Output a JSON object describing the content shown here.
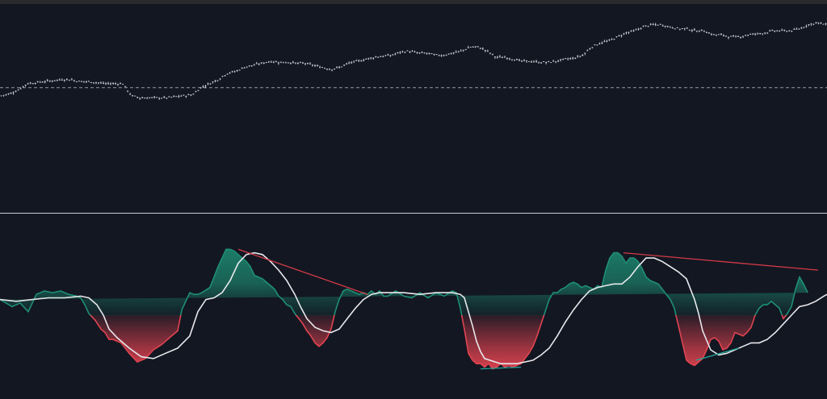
{
  "theme": {
    "background": "#131722",
    "top_bar": "#2a2a2d",
    "candle_color": "#c2c4cb",
    "reference_line_color": "#9598a1",
    "pane_separator_color": "#c9cbd1",
    "bull_fill": "#1f8f74",
    "bear_fill": "#e04451",
    "signal_line": "#e8e8ec",
    "divergence_bear": "#d33a47",
    "divergence_bull": "#26a69a"
  },
  "chart_data": [
    {
      "type": "candlestick",
      "title": "",
      "xlabel": "",
      "ylabel": "",
      "ylim": [
        0,
        100
      ],
      "reference_line": 60,
      "close": [
        56,
        57,
        59,
        62,
        62.5,
        63,
        63.5,
        64,
        64,
        63,
        63,
        62.5,
        62,
        62,
        62,
        56,
        55,
        55,
        55,
        55,
        55.5,
        56,
        56.5,
        60,
        62,
        64,
        67,
        68,
        70,
        71,
        72,
        73,
        72.5,
        72.5,
        72,
        72,
        71,
        70,
        69,
        70,
        72,
        73,
        74,
        75,
        75.5,
        76,
        77.5,
        78,
        77,
        77,
        76,
        76,
        77,
        78,
        80,
        80,
        78,
        75,
        75,
        74,
        73,
        73,
        72.5,
        72.5,
        73,
        74,
        74.5,
        76,
        80,
        82,
        83,
        85,
        87,
        88,
        90,
        91,
        91,
        90,
        89,
        89,
        88,
        88,
        86,
        86,
        85,
        85,
        86,
        86.5,
        87,
        88,
        88,
        88,
        89,
        91,
        92,
        91
      ]
    },
    {
      "type": "area",
      "title": "",
      "xlabel": "",
      "ylabel": "",
      "ylim": [
        -3.5,
        4.5
      ],
      "baseline": 0,
      "x": [
        0,
        15,
        25,
        35,
        45,
        55,
        65,
        75,
        85,
        95,
        100,
        105,
        110,
        118,
        125,
        130,
        135,
        140,
        150,
        160,
        170,
        180,
        190,
        200,
        210,
        220,
        225,
        230,
        235,
        240,
        245,
        250,
        260,
        270,
        280,
        285,
        290,
        295,
        300,
        305,
        310,
        315,
        320,
        325,
        330,
        335,
        340,
        345,
        350,
        355,
        360,
        365,
        370,
        375,
        380,
        385,
        390,
        395,
        400,
        405,
        410,
        415,
        420,
        425,
        430,
        435,
        440,
        445,
        450,
        455,
        460,
        465,
        470,
        475,
        480,
        490,
        500,
        510,
        520,
        530,
        540,
        550,
        560,
        565,
        570,
        575,
        580,
        585,
        590,
        595,
        600,
        605,
        610,
        615,
        620,
        625,
        630,
        635,
        640,
        645,
        650,
        655,
        660,
        665,
        670,
        675,
        680,
        685,
        690,
        695,
        700,
        705,
        710,
        715,
        720,
        725,
        730,
        735,
        740,
        745,
        750,
        755,
        760,
        765,
        770,
        775,
        780,
        785,
        790,
        795,
        800,
        805,
        810,
        815,
        820,
        825,
        830,
        835,
        840,
        845,
        850,
        855,
        860,
        865,
        870,
        875,
        880,
        885,
        890,
        895,
        900,
        905,
        910,
        915,
        920,
        925,
        930,
        935,
        940,
        945,
        950,
        955,
        960,
        965,
        970,
        975,
        980,
        985,
        990,
        995,
        1000,
        1005,
        1010,
        1015,
        1020,
        1024
      ],
      "value": [
        0.9,
        0.5,
        0.7,
        0.2,
        1.2,
        1.4,
        1.3,
        1.4,
        1.2,
        1.1,
        1.0,
        0.6,
        0.1,
        -0.3,
        -0.8,
        -1.0,
        -1.4,
        -1.4,
        -1.6,
        -2.2,
        -2.7,
        -2.5,
        -2.0,
        -1.7,
        -1.3,
        -0.9,
        0.3,
        0.8,
        1.3,
        1.2,
        1.2,
        1.3,
        1.6,
        2.8,
        3.8,
        3.8,
        3.7,
        3.5,
        3.3,
        3.1,
        2.8,
        2.3,
        2.2,
        2.1,
        1.9,
        1.7,
        1.5,
        1.1,
        0.9,
        0.6,
        0.5,
        0.1,
        -0.2,
        -0.5,
        -0.9,
        -1.2,
        -1.6,
        -1.8,
        -1.6,
        -1.3,
        -0.8,
        0.2,
        0.9,
        1.4,
        1.5,
        1.4,
        1.3,
        1.2,
        1.3,
        1.2,
        1.4,
        1.2,
        1.4,
        1.1,
        1.1,
        1.4,
        1.1,
        1.0,
        1.3,
        1.0,
        1.3,
        1.1,
        1.4,
        1.3,
        0.4,
        -0.8,
        -2.2,
        -2.6,
        -2.8,
        -2.8,
        -3.0,
        -2.8,
        -3.1,
        -3.0,
        -2.8,
        -3.0,
        -2.9,
        -3.0,
        -2.9,
        -2.8,
        -2.5,
        -2.2,
        -1.8,
        -1.2,
        -0.5,
        0.2,
        0.9,
        1.3,
        1.3,
        1.5,
        1.6,
        1.8,
        1.9,
        1.8,
        1.6,
        1.7,
        1.6,
        1.5,
        1.7,
        1.6,
        2.6,
        3.3,
        3.6,
        3.6,
        3.4,
        3.0,
        3.3,
        3.3,
        3.1,
        2.7,
        2.2,
        2.0,
        1.9,
        1.8,
        1.5,
        1.2,
        0.9,
        0.4,
        -0.6,
        -1.6,
        -2.6,
        -2.8,
        -2.9,
        -2.7,
        -2.5,
        -2.0,
        -1.4,
        -1.3,
        -1.5,
        -2.0,
        -1.9,
        -1.6,
        -1.0,
        -1.1,
        -1.2,
        -1.0,
        -0.7,
        0.0,
        0.4,
        0.6,
        0.6,
        0.8,
        0.6,
        0.4,
        -0.2,
        0.1,
        0.5,
        1.5,
        2.2,
        1.8,
        1.3
      ]
    },
    {
      "type": "line",
      "title": "",
      "xlabel": "",
      "ylabel": "",
      "x": [
        0,
        20,
        40,
        60,
        80,
        100,
        110,
        120,
        128,
        135,
        145,
        160,
        175,
        190,
        205,
        220,
        235,
        245,
        255,
        265,
        275,
        285,
        295,
        305,
        315,
        325,
        335,
        345,
        355,
        365,
        372,
        380,
        390,
        400,
        410,
        420,
        430,
        440,
        450,
        460,
        470,
        480,
        500,
        520,
        540,
        560,
        570,
        575,
        580,
        585,
        590,
        595,
        600,
        620,
        640,
        660,
        670,
        680,
        690,
        700,
        710,
        720,
        730,
        740,
        750,
        760,
        770,
        780,
        790,
        800,
        810,
        820,
        830,
        840,
        850,
        855,
        860,
        865,
        870,
        880,
        890,
        900,
        910,
        920,
        930,
        940,
        950,
        960,
        970,
        980,
        990,
        1000,
        1010,
        1020,
        1024
      ],
      "value": [
        0.9,
        0.8,
        0.9,
        1.0,
        1.0,
        1.1,
        1.0,
        0.6,
        0.0,
        -0.8,
        -1.3,
        -1.9,
        -2.4,
        -2.5,
        -2.2,
        -1.9,
        -1.2,
        0.2,
        0.9,
        1.0,
        1.3,
        2.0,
        3.0,
        3.5,
        3.6,
        3.5,
        3.1,
        2.6,
        2.0,
        1.2,
        0.5,
        -0.2,
        -0.7,
        -0.9,
        -1.0,
        -0.8,
        -0.2,
        0.4,
        0.9,
        1.2,
        1.3,
        1.3,
        1.3,
        1.2,
        1.3,
        1.3,
        1.2,
        1.0,
        0.2,
        -0.6,
        -1.5,
        -2.1,
        -2.5,
        -2.8,
        -2.8,
        -2.6,
        -2.3,
        -1.9,
        -1.2,
        -0.4,
        0.3,
        0.9,
        1.4,
        1.6,
        1.7,
        1.8,
        1.8,
        2.2,
        2.8,
        3.3,
        3.3,
        3.1,
        2.8,
        2.5,
        2.1,
        1.5,
        0.9,
        0.1,
        -0.9,
        -2.0,
        -2.3,
        -2.2,
        -2.0,
        -1.8,
        -1.6,
        -1.6,
        -1.4,
        -1.0,
        -0.5,
        0.0,
        0.5,
        0.6,
        0.8,
        1.1,
        1.2
      ]
    }
  ],
  "divergences": [
    {
      "kind": "bearish",
      "from": [
        295,
        3.8
      ],
      "to": [
        455,
        1.2
      ]
    },
    {
      "kind": "bearish",
      "from": [
        772,
        3.6
      ],
      "to": [
        1013,
        2.6
      ]
    },
    {
      "kind": "bullish",
      "from": [
        595,
        -3.1
      ],
      "to": [
        645,
        -3.0
      ]
    },
    {
      "kind": "bullish",
      "from": [
        862,
        -2.6
      ],
      "to": [
        915,
        -1.9
      ]
    }
  ]
}
